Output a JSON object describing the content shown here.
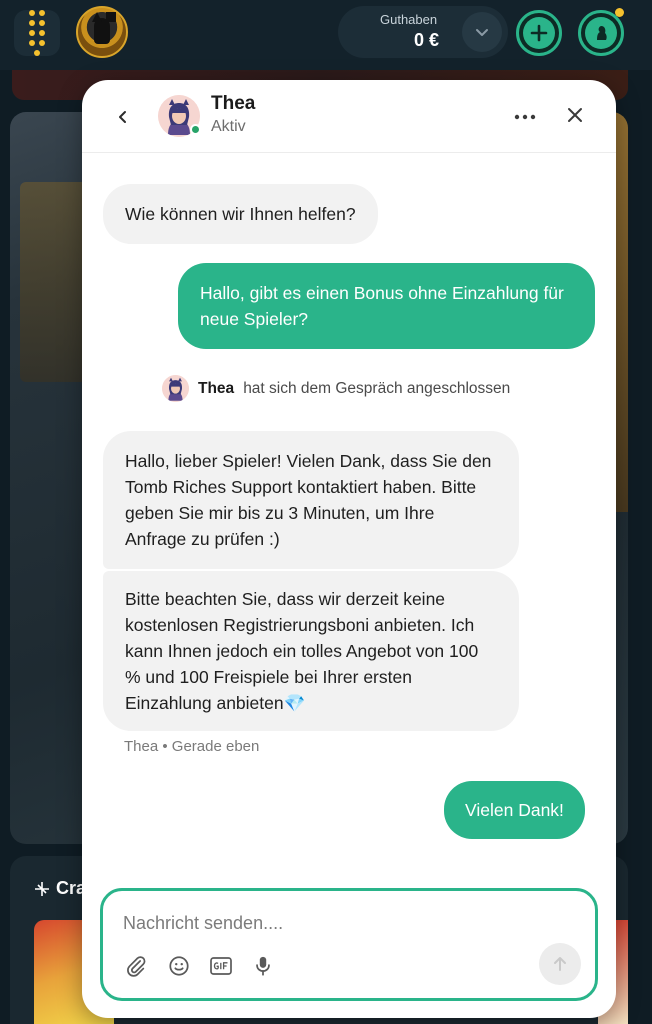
{
  "header": {
    "balance_label": "Guthaben",
    "balance_value": "0 €"
  },
  "background": {
    "section_title": "Cra"
  },
  "chat": {
    "agent_name": "Thea",
    "agent_status": "Aktiv",
    "messages": {
      "greeting": "Wie können wir Ihnen helfen?",
      "user_question": "Hallo, gibt es einen Bonus ohne Einzahlung für neue Spieler?",
      "joined_name": "Thea",
      "joined_text": "hat sich dem Gespräch angeschlossen",
      "agent_reply_1": "Hallo, lieber Spieler! Vielen Dank, dass Sie den Tomb Riches Support kontaktiert haben. Bitte geben Sie mir bis zu 3 Minuten, um Ihre Anfrage zu prüfen :)",
      "agent_reply_2": "Bitte beachten Sie, dass wir derzeit keine kostenlosen Registrierungsboni anbieten. Ich kann Ihnen jedoch ein tolles Angebot von 100 % und 100 Freispiele bei Ihrer ersten Einzahlung anbieten💎",
      "meta": "Thea • Gerade eben",
      "user_thanks": "Vielen Dank!"
    },
    "composer": {
      "placeholder": "Nachricht senden....",
      "value": ""
    }
  },
  "icons": {
    "menu": "grid-icon",
    "balance_toggle": "chevron-down-icon",
    "deposit": "plus-icon",
    "profile": "profile-icon",
    "back": "chevron-left-icon",
    "more": "more-icon",
    "close": "close-icon",
    "attach": "paperclip-icon",
    "emoji": "emoji-icon",
    "gif": "gif-icon",
    "mic": "microphone-icon",
    "send": "send-arrow-icon"
  },
  "colors": {
    "accent": "#2ab48a",
    "page_background": "#0f1c24",
    "highlight": "#f5c12e",
    "online": "#27a368"
  }
}
